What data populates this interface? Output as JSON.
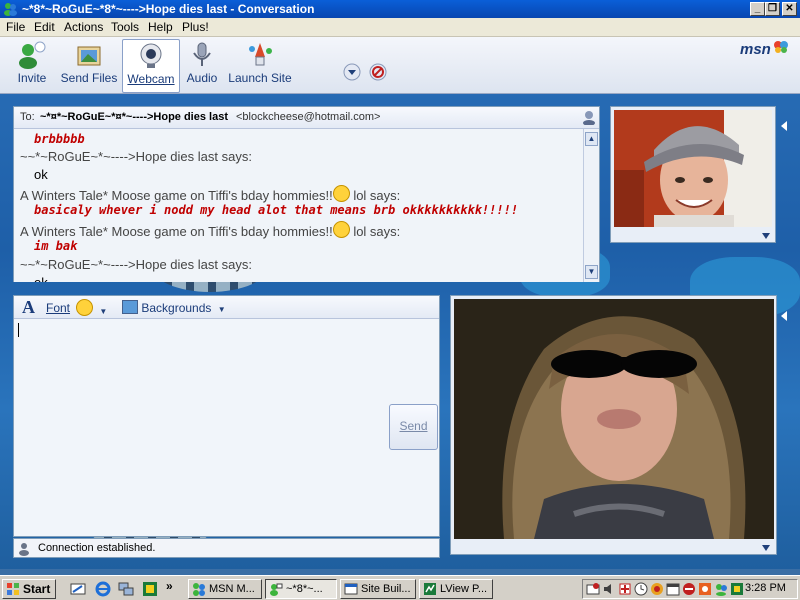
{
  "window": {
    "title": "~*8*~RoGuE~*8*~---->Hope dies last - Conversation",
    "minimize": "_",
    "maximize": "❐",
    "close": "✕"
  },
  "menu": [
    "File",
    "Edit",
    "Actions",
    "Tools",
    "Help",
    "Plus!"
  ],
  "toolbar": {
    "buttons": [
      "Invite",
      "Send Files",
      "Webcam",
      "Audio",
      "Launch Site"
    ],
    "brand": "msn"
  },
  "conversation": {
    "to_label": "To:",
    "to_name": "~*¤*~RoGuE~*¤*~---->Hope dies last",
    "to_email": "<blockcheese@hotmail.com>",
    "lines": [
      {
        "kind": "msg-red",
        "text": "brbbbbb"
      },
      {
        "kind": "says",
        "text": "~~*~RoGuE~*~---->Hope dies last says:"
      },
      {
        "kind": "msg",
        "text": "ok"
      },
      {
        "kind": "says-emote",
        "before": "A Winters Tale*        Moose game on Tiffi's bday hommies!!",
        "after": " lol says:"
      },
      {
        "kind": "msg-red",
        "text": "basicaly whever i nodd my head alot that means brb okkkkkkkkkk!!!!!"
      },
      {
        "kind": "says-emote",
        "before": "A Winters Tale*        Moose game on Tiffi's bday hommies!!",
        "after": " lol says:"
      },
      {
        "kind": "msg-red",
        "text": "im bak"
      },
      {
        "kind": "says",
        "text": "~~*~RoGuE~*~---->Hope dies last says:"
      },
      {
        "kind": "msg",
        "text": "ok"
      }
    ]
  },
  "compose": {
    "font_label": "Font",
    "backgrounds_label": "Backgrounds",
    "send_label": "Send",
    "status": "Connection established."
  },
  "taskbar": {
    "start": "Start",
    "tasks": [
      "MSN M...",
      "~*8*~...",
      "Site Buil...",
      "LView P..."
    ],
    "clock": "3:28 PM"
  },
  "colors": {
    "title_bar": "#0a5fd8",
    "red_message": "#c00000",
    "toolbar_text": "#1b3c7a"
  }
}
